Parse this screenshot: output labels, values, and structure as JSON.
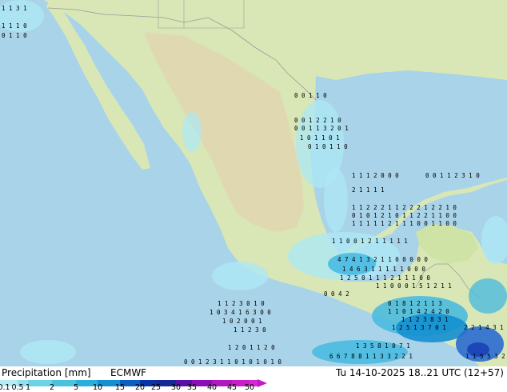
{
  "legend": {
    "title": "Precipitation [mm]",
    "model": "ECMWF",
    "valid_time": "Tu 14-10-2025 18..21 UTC (12+57)",
    "scale_labels": [
      "0.1",
      "0.5",
      "1",
      "2",
      "5",
      "10",
      "15",
      "20",
      "25",
      "30",
      "35",
      "40",
      "45",
      "50"
    ],
    "scale_colors": [
      "#b4ecf4",
      "#92e0ee",
      "#6dd2e6",
      "#4ac2de",
      "#2aaedb",
      "#148fd0",
      "#0c5ec0",
      "#0a33a8",
      "#152896",
      "#5a10a6",
      "#8a0fb4",
      "#b018be",
      "#c81cc8",
      "#d826d6"
    ]
  },
  "map": {
    "water_color": "#a9d3e8",
    "land_color": "#d8e7b5",
    "highland_color": "#e2d5b0",
    "border_color": "#9a9a9a",
    "rain_light": "#aee8f5",
    "rain_moderate": "#44b8e0",
    "rain_heavy": "#1b43b7"
  },
  "values_rows": [
    {
      "text": "1 1 3 1"
    },
    {
      "text": "1 1 1 0"
    },
    {
      "text": "0 1 1 0"
    },
    {
      "text": "0 0 1 1 0"
    },
    {
      "text": "0 0 1 2 2 1 0"
    },
    {
      "text": "0 0 1 1 3 2 0 1"
    },
    {
      "text": "1 0 1 1 0 1"
    },
    {
      "text": "0 1 0 1 1 0"
    },
    {
      "text": "1 1 1 2 0 0 0"
    },
    {
      "text": "0 0 1 1 2 3 1 0"
    },
    {
      "text": "2 1 1 1 1"
    },
    {
      "text": "1 1 2 2 2 1 1 2 2 2 1 2 2 1 0"
    },
    {
      "text": "0 1 0 1 2 1 0 1 1 2 2 1 1 0 0"
    },
    {
      "text": "1 1 1 1 1 2 1 1 1 0 0 1 1 0 0"
    },
    {
      "text": "1 1 0 0 1 2 1 1 1 1 1"
    },
    {
      "text": "4 7 4 1 3 2 1 1 0 0 0 0 0"
    },
    {
      "text": "1 4 6 3 1 1 1 1 1 0 0 0"
    },
    {
      "text": "1 2 5 0 1 1 1 2 1 1 1 0 0"
    },
    {
      "text": "1 1 0 0 0 1 5 1 2 1 1"
    },
    {
      "text": "0 0 4 2"
    },
    {
      "text": "0 1 8 1 2 1 1 3"
    },
    {
      "text": "1 1 0 1 4 2 4 2 0"
    },
    {
      "text": "1 1 2 3 8 3 1"
    },
    {
      "text": "1 2 5 1 3 7 0 1"
    },
    {
      "text": "1 1 2 3 0 1 0"
    },
    {
      "text": "1 0 3 4 1 6 3 0 0"
    },
    {
      "text": "1 0 2 0 0 1"
    },
    {
      "text": "1 1 2 3 0"
    },
    {
      "text": "1 2 0 1 1 2 0"
    },
    {
      "text": "6 6 7 8 8 1 1 3 3 2 2 1"
    },
    {
      "text": "1 3 5 8 1 0 7 1"
    },
    {
      "text": "2 2 1 4 3 1"
    },
    {
      "text": "1 1 5 5 3 2"
    },
    {
      "text": "0 0 1 2 3 1 1 0 1 0 1 0 1 0"
    }
  ]
}
